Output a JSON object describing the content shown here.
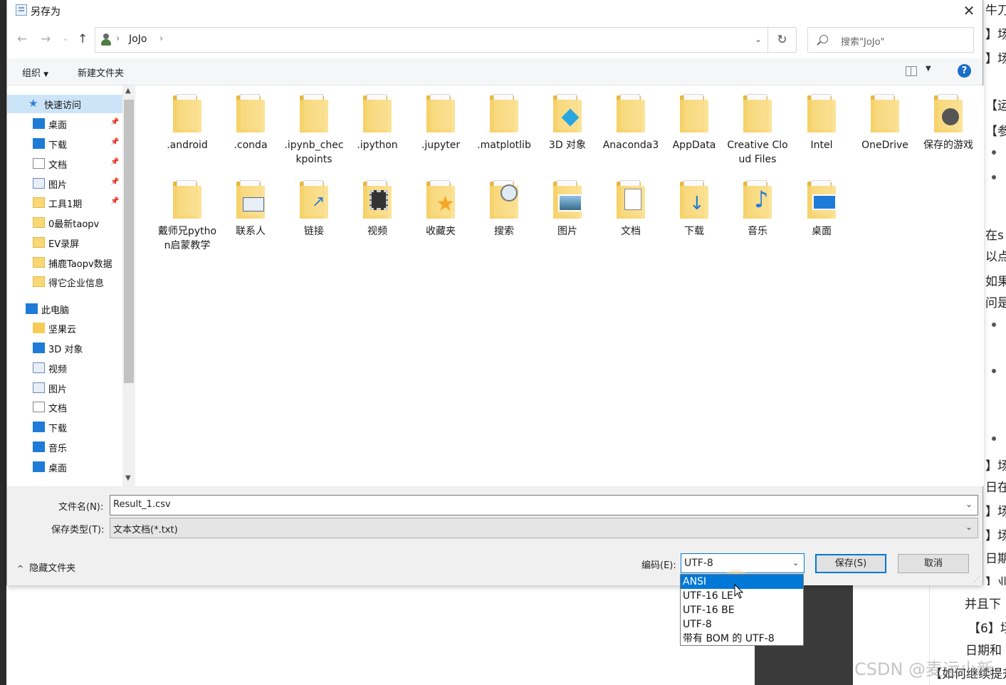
{
  "window": {
    "title": "另存为"
  },
  "nav": {
    "breadcrumb": [
      "JoJo"
    ],
    "search_placeholder": "搜索\"JoJo\""
  },
  "toolbar": {
    "organize_label": "组织",
    "new_folder_label": "新建文件夹",
    "help_label": "?"
  },
  "sidebar": {
    "items": [
      {
        "label": "快速访问",
        "icon": "star-icon",
        "pinned": false,
        "selected": true
      },
      {
        "label": "桌面",
        "icon": "desktop-icon",
        "pinned": true
      },
      {
        "label": "下载",
        "icon": "download-icon",
        "pinned": true
      },
      {
        "label": "文档",
        "icon": "document-icon",
        "pinned": true
      },
      {
        "label": "图片",
        "icon": "pictures-icon",
        "pinned": true
      },
      {
        "label": "工具1期",
        "icon": "folder-icon",
        "pinned": true
      },
      {
        "label": "0最新taopv",
        "icon": "folder-icon",
        "pinned": false
      },
      {
        "label": "EV录屏",
        "icon": "folder-icon",
        "pinned": false
      },
      {
        "label": "捕鹿Taopv数据",
        "icon": "folder-icon",
        "pinned": false
      },
      {
        "label": "得它企业信息",
        "icon": "folder-icon",
        "pinned": false
      },
      {
        "label": "此电脑",
        "icon": "computer-icon",
        "pinned": false
      },
      {
        "label": "坚果云",
        "icon": "nut-cloud-icon",
        "pinned": false
      },
      {
        "label": "3D 对象",
        "icon": "3d-objects-icon",
        "pinned": false
      },
      {
        "label": "视频",
        "icon": "video-icon",
        "pinned": false
      },
      {
        "label": "图片",
        "icon": "pictures-icon",
        "pinned": false
      },
      {
        "label": "文档",
        "icon": "document-icon",
        "pinned": false
      },
      {
        "label": "下载",
        "icon": "download-icon",
        "pinned": false
      },
      {
        "label": "音乐",
        "icon": "music-icon",
        "pinned": false
      },
      {
        "label": "桌面",
        "icon": "desktop-icon",
        "pinned": false
      }
    ]
  },
  "files": [
    {
      "name": ".android",
      "icon": "folder-icon"
    },
    {
      "name": ".conda",
      "icon": "folder-icon"
    },
    {
      "name": ".ipynb_checkpoints",
      "icon": "folder-icon"
    },
    {
      "name": ".ipython",
      "icon": "folder-icon"
    },
    {
      "name": ".jupyter",
      "icon": "folder-icon"
    },
    {
      "name": ".matplotlib",
      "icon": "folder-icon"
    },
    {
      "name": "3D 对象",
      "icon": "3d-objects-folder-icon"
    },
    {
      "name": "Anaconda3",
      "icon": "folder-icon"
    },
    {
      "name": "AppData",
      "icon": "folder-icon"
    },
    {
      "name": "Creative Cloud Files",
      "icon": "folder-icon"
    },
    {
      "name": "Intel",
      "icon": "folder-icon"
    },
    {
      "name": "OneDrive",
      "icon": "folder-icon"
    },
    {
      "name": "保存的游戏",
      "icon": "saved-games-folder-icon"
    },
    {
      "name": "戴师兄python启蒙教学",
      "icon": "folder-icon"
    },
    {
      "name": "联系人",
      "icon": "contacts-folder-icon"
    },
    {
      "name": "链接",
      "icon": "links-folder-icon"
    },
    {
      "name": "视频",
      "icon": "video-folder-icon"
    },
    {
      "name": "收藏夹",
      "icon": "favorites-folder-icon"
    },
    {
      "name": "搜索",
      "icon": "search-folder-icon"
    },
    {
      "name": "图片",
      "icon": "pictures-folder-icon"
    },
    {
      "name": "文档",
      "icon": "documents-folder-icon"
    },
    {
      "name": "下载",
      "icon": "downloads-folder-icon"
    },
    {
      "name": "音乐",
      "icon": "music-folder-icon"
    },
    {
      "name": "桌面",
      "icon": "desktop-folder-icon"
    }
  ],
  "form": {
    "filename_label": "文件名(N):",
    "filename_value": "Result_1.csv",
    "filetype_label": "保存类型(T):",
    "filetype_value": "文本文档(*.txt)",
    "hide_folders_label": "隐藏文件夹",
    "encoding_label": "编码(E):",
    "encoding_value": "UTF-8",
    "save_label": "保存(S)",
    "cancel_label": "取消"
  },
  "encoding_options": [
    "ANSI",
    "UTF-16 LE",
    "UTF-16 BE",
    "UTF-8",
    "带有 BOM 的 UTF-8"
  ],
  "encoding_highlighted": "ANSI",
  "background": {
    "right_edge_fragments": [
      "牛刀",
      "】场",
      "】场",
      "【运",
      "【参",
      "在s",
      "以点",
      "如果",
      "问是",
      "】场",
      "日在",
      "】场",
      "】场",
      "日期",
      "】业"
    ],
    "bottom_fragments": [
      "并且下",
      "【6】场",
      "日期和",
      "【如何继续提升"
    ],
    "watermark": "CSDN @麦运小新"
  },
  "colors": {
    "accent": "#0078d7",
    "selection": "#cce4f7",
    "folder": "#f6cc57",
    "help": "#1a6fc9"
  }
}
